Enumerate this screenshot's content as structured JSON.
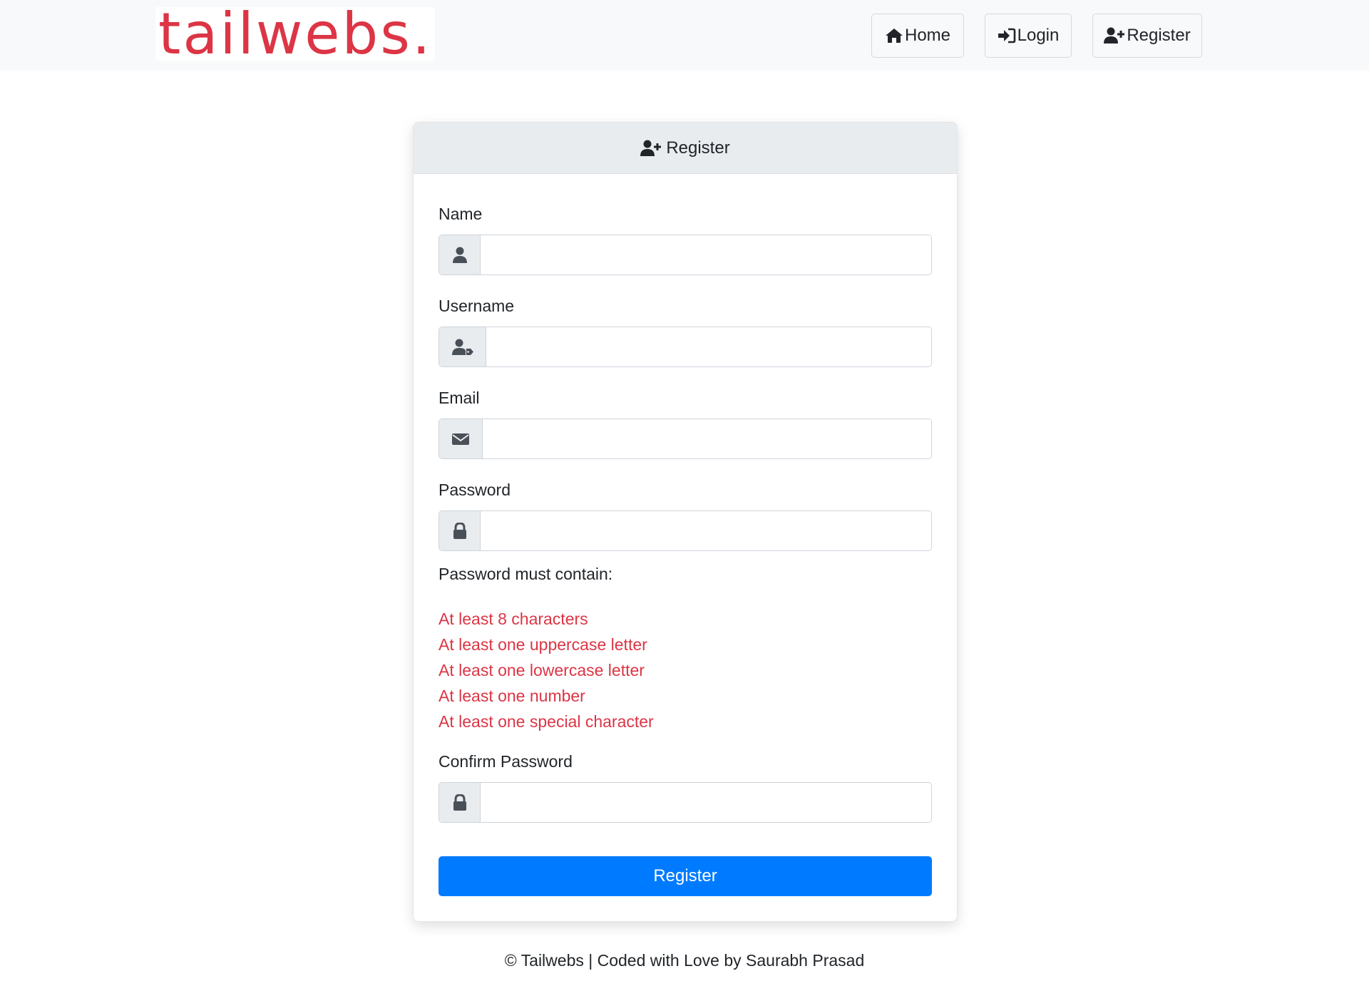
{
  "nav": {
    "brand": "tailwebs.",
    "home_label": "Home",
    "login_label": "Login",
    "register_label": "Register"
  },
  "card": {
    "title": "Register"
  },
  "form": {
    "name_label": "Name",
    "name_value": "",
    "username_label": "Username",
    "username_value": "",
    "email_label": "Email",
    "email_value": "",
    "password_label": "Password",
    "password_value": "",
    "password_rules_title": "Password must contain:",
    "password_rules": [
      "At least 8 characters",
      "At least one uppercase letter",
      "At least one lowercase letter",
      "At least one number",
      "At least one special character"
    ],
    "confirm_label": "Confirm Password",
    "confirm_value": "",
    "submit_label": "Register"
  },
  "footer": {
    "text": "© Tailwebs | Coded with Love by Saurabh Prasad"
  },
  "colors": {
    "brand": "#dc3545",
    "primary": "#007bff",
    "rule_text": "#dc3545",
    "navbar_bg": "#f8f9fa",
    "card_header_bg": "#e9ecef"
  },
  "icons": {
    "home": "home-icon",
    "login": "sign-in-icon",
    "register": "user-plus-icon",
    "name": "user-icon",
    "username": "user-tag-icon",
    "email": "envelope-icon",
    "password": "lock-icon",
    "confirm": "lock-icon"
  }
}
